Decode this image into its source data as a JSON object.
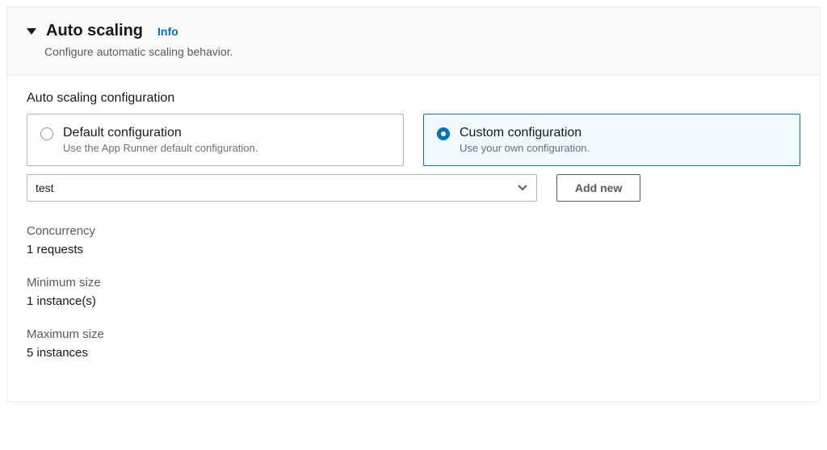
{
  "header": {
    "title": "Auto scaling",
    "info": "Info",
    "subtitle": "Configure automatic scaling behavior."
  },
  "section_label": "Auto scaling configuration",
  "radio": {
    "default": {
      "title": "Default configuration",
      "desc": "Use the App Runner default configuration."
    },
    "custom": {
      "title": "Custom configuration",
      "desc": "Use your own configuration."
    }
  },
  "select": {
    "value": "test"
  },
  "buttons": {
    "add_new": "Add new"
  },
  "fields": {
    "concurrency": {
      "label": "Concurrency",
      "value": "1 requests"
    },
    "min_size": {
      "label": "Minimum size",
      "value": "1 instance(s)"
    },
    "max_size": {
      "label": "Maximum size",
      "value": "5 instances"
    }
  }
}
